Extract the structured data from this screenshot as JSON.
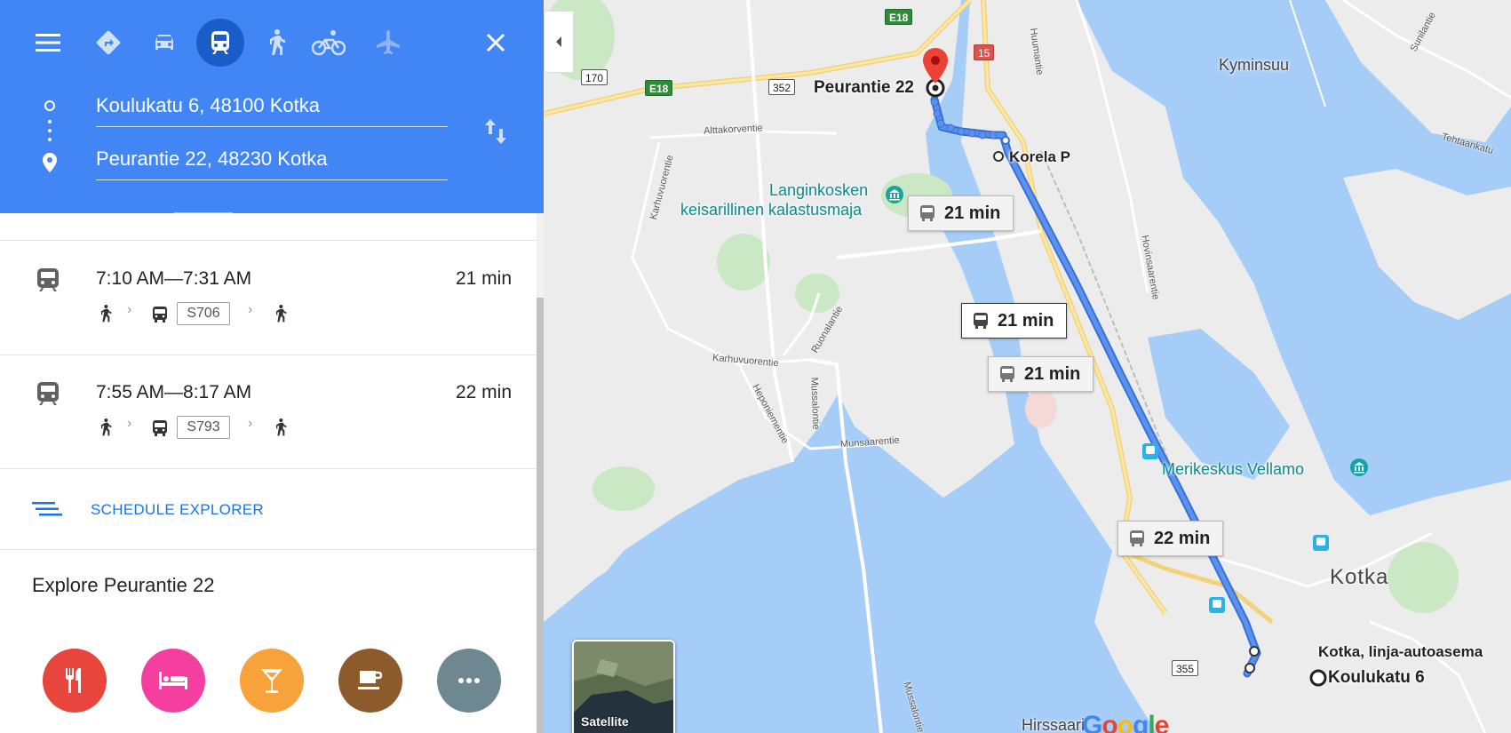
{
  "header": {
    "origin": "Koulukatu 6, 48100 Kotka",
    "destination": "Peurantie 22, 48230 Kotka",
    "modes": [
      "best-route",
      "driving",
      "transit",
      "walking",
      "cycling",
      "flights"
    ],
    "active_mode": "transit",
    "accent_color": "#4285f4"
  },
  "trips": [
    {
      "times": "7:10 AM—7:31 AM",
      "duration": "21 min",
      "bus_line": "S706"
    },
    {
      "times": "7:55 AM—8:17 AM",
      "duration": "22 min",
      "bus_line": "S793"
    }
  ],
  "schedule_explorer": {
    "label": "SCHEDULE EXPLORER"
  },
  "explore": {
    "title": "Explore Peurantie 22",
    "categories": [
      {
        "name": "restaurants",
        "color": "#e8453c"
      },
      {
        "name": "hotels",
        "color": "#f43fa1"
      },
      {
        "name": "bars",
        "color": "#f7a23b"
      },
      {
        "name": "coffee",
        "color": "#8d5a2b"
      },
      {
        "name": "more",
        "color": "#6f8790"
      }
    ]
  },
  "map": {
    "labels": {
      "destination": "Peurantie 22",
      "origin": "Koulukatu 6",
      "stop_korela": "Korela P",
      "stop_bus_station": "Kotka, linja-autoasema",
      "kyminsuu": "Kyminsuu",
      "kotka": "Kotka",
      "hirssaari": "Hirssaari",
      "poi_langinkoski_1": "Langinkosken",
      "poi_langinkoski_2": "keisarillinen kalastusmaja",
      "poi_vellamo": "Merikeskus Vellamo",
      "street_alttakorventie": "Alttakorventie",
      "street_karhuvuorentie_v": "Karhuvuorentie",
      "street_karhuvuorentie_h": "Karhuvuorentie",
      "street_ruonalantie": "Ruonalantie",
      "street_heponiementie": "Heponiementie",
      "street_mussalontie": "Mussalontie",
      "street_munsaarentie": "Munsaarentie",
      "street_huumantie": "Huumantie",
      "street_hovinsaarentie": "Hovinsaarentie",
      "street_sunilantie": "Sunilantie",
      "street_tehtaankatu": "Tehtaankatu",
      "street_mussalontie_s": "Mussalontie"
    },
    "roads": {
      "e18_a": "E18",
      "e18_b": "E18",
      "r15": "15",
      "r170": "170",
      "r352": "352",
      "r355": "355"
    },
    "route_durations": [
      "21 min",
      "21 min",
      "21 min",
      "22 min"
    ],
    "satellite_label": "Satellite",
    "logo": "Google",
    "route_color": "#4a84e8",
    "water_color": "#a6cdf7",
    "land_color": "#ececec"
  }
}
